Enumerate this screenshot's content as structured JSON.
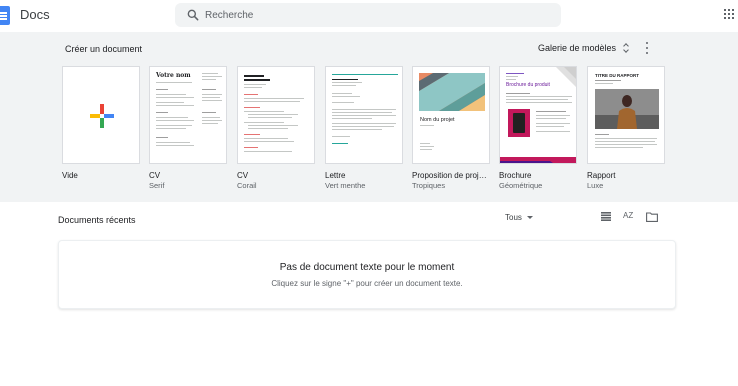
{
  "app": {
    "name": "Docs"
  },
  "search": {
    "placeholder": "Recherche"
  },
  "templates": {
    "section_title": "Créer un document",
    "gallery_label": "Galerie de modèles",
    "items": [
      {
        "name": "Vide",
        "subtitle": ""
      },
      {
        "name": "CV",
        "subtitle": "Serif"
      },
      {
        "name": "CV",
        "subtitle": "Corail"
      },
      {
        "name": "Lettre",
        "subtitle": "Vert menthe"
      },
      {
        "name": "Proposition de proj…",
        "subtitle": "Tropiques"
      },
      {
        "name": "Brochure",
        "subtitle": "Géométrique"
      },
      {
        "name": "Rapport",
        "subtitle": "Luxe"
      }
    ],
    "thumb_text": {
      "serif_name": "Votre nom",
      "project_name": "Nom du projet",
      "brochure_title": "Brochure du produit",
      "report_title": "TITRE DU RAPPORT"
    }
  },
  "recent": {
    "title": "Documents récents",
    "owner_filter": "Tous",
    "sort_label": "AZ",
    "empty_title": "Pas de document texte pour le moment",
    "empty_subtitle": "Cliquez sur le signe \"+\" pour créer un document texte."
  },
  "colors": {
    "docs_blue": "#4285f4",
    "band_bg": "#f1f3f4",
    "plus_red": "#ea4335",
    "plus_blue": "#4285f4",
    "plus_green": "#34a853",
    "plus_yellow": "#fbbc04"
  }
}
